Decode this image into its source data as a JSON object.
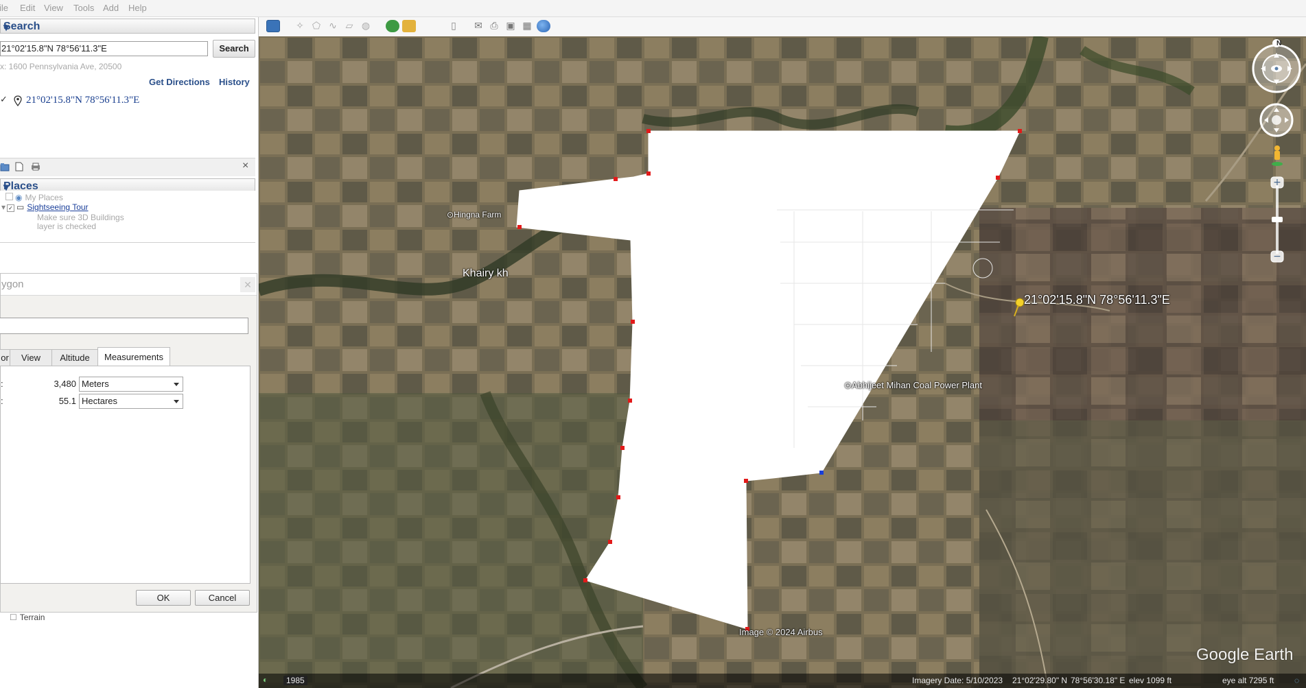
{
  "menu": [
    {
      "label": "File",
      "display": "ile"
    },
    {
      "label": "Edit"
    },
    {
      "label": "View"
    },
    {
      "label": "Tools"
    },
    {
      "label": "Add"
    },
    {
      "label": "Help"
    }
  ],
  "search": {
    "header": "Search",
    "query": "21°02'15.8\"N 78°56'11.3\"E",
    "button_label": "Search",
    "hint": "x: 1600 Pennsylvania Ave, 20500",
    "get_directions": "Get Directions",
    "history": "History",
    "result": "21°02'15.8\"N 78°56'11.3\"E"
  },
  "places": {
    "header": "Places",
    "my_places": "My Places",
    "tour": "Sightseeing Tour",
    "tour_desc": "Make sure 3D Buildings",
    "tour_desc2": "layer is checked",
    "terrain": "Terrain"
  },
  "dialog": {
    "title": "ygon",
    "tabs": [
      "or",
      "View",
      "Altitude",
      "Measurements"
    ],
    "active_tab": "Measurements",
    "perimeter_label": ":",
    "perimeter_value": "3,480",
    "perimeter_unit": "Meters",
    "area_label": ":",
    "area_value": "55.1",
    "area_unit": "Hectares",
    "ok": "OK",
    "cancel": "Cancel"
  },
  "map": {
    "labels": {
      "farm": "Hingna Farm",
      "village": "Khairy kh",
      "plant": "Abhijeet Mihan Coal Power Plant",
      "pin": "21°02'15.8\"N 78°56'11.3\"E",
      "credit": "Image © 2024 Airbus",
      "logo": "Google Earth"
    },
    "status": {
      "year": "1985",
      "imagery_date": "Imagery Date: 5/10/2023",
      "lat": "21°02'29.80\" N",
      "lon": "78°56'30.18\" E",
      "elev": "elev  1099 ft",
      "eye_alt": "eye alt  7295 ft"
    },
    "compass_north": "N"
  },
  "colors": {
    "polygon_fill": "#ffffff",
    "vertex": "#e21a1a",
    "vertex_selected": "#1a3fd8",
    "link": "#1a3f8f",
    "header_text": "#2a4f8a"
  }
}
